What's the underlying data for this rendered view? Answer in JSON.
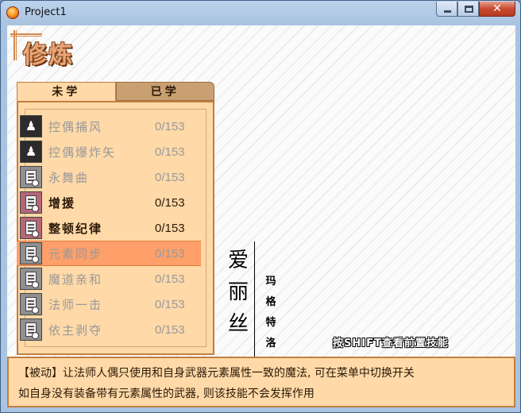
{
  "window": {
    "title": "Project1",
    "close_glyph": "✕"
  },
  "header": {
    "title": "修炼"
  },
  "tabs": [
    {
      "label": "未学",
      "active": true
    },
    {
      "label": "已学",
      "active": false
    }
  ],
  "skills": [
    {
      "name": "控偶捕风",
      "count": "0/153",
      "icon": "puppet-icon",
      "state": "dim"
    },
    {
      "name": "控偶爆炸矢",
      "count": "0/153",
      "icon": "puppet-icon",
      "state": "dim"
    },
    {
      "name": "永舞曲",
      "count": "0/153",
      "icon": "scroll-icon",
      "state": "dim"
    },
    {
      "name": "增援",
      "count": "0/153",
      "icon": "scroll-icon",
      "state": "lit"
    },
    {
      "name": "整顿纪律",
      "count": "0/153",
      "icon": "scroll-icon",
      "state": "lit"
    },
    {
      "name": "元素同步",
      "count": "0/153",
      "icon": "scroll-icon",
      "state": "selected"
    },
    {
      "name": "魔道亲和",
      "count": "0/153",
      "icon": "scroll-icon",
      "state": "dim"
    },
    {
      "name": "法师一击",
      "count": "0/153",
      "icon": "scroll-icon",
      "state": "dim"
    },
    {
      "name": "依主剥夺",
      "count": "0/153",
      "icon": "scroll-icon",
      "state": "dim"
    }
  ],
  "character": {
    "name_chars": [
      "爱",
      "丽",
      "丝"
    ],
    "sub_chars": [
      "玛",
      "格",
      "特",
      "洛"
    ]
  },
  "hint": "按SHIFT查看前置技能",
  "description": {
    "line1": "【被动】让法师人偶只使用和自身武器元素属性一致的魔法, 可在菜单中切换开关",
    "line2": "如自身没有装备带有元素属性的武器, 则该技能不会发挥作用"
  },
  "colors": {
    "panel": "#ffd9a8",
    "panel_border": "#c08040",
    "selected_row": "#ff9f6a",
    "title_accent": "#e9a779"
  }
}
